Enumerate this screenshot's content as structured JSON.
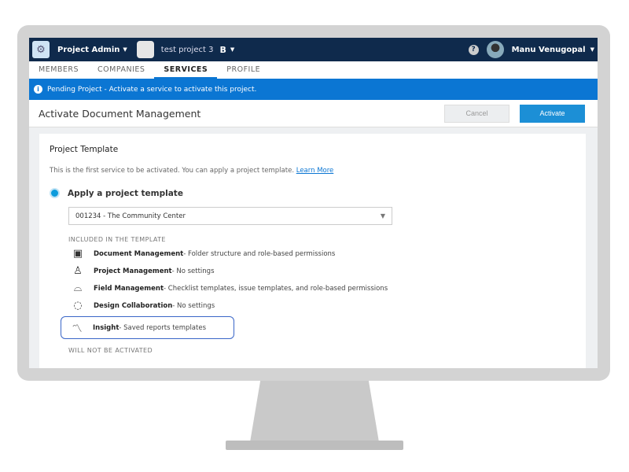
{
  "header": {
    "app_menu": "Project Admin",
    "project": "test project 3",
    "project_badge": "B",
    "user": "Manu Venugopal"
  },
  "tabs": [
    "MEMBERS",
    "COMPANIES",
    "SERVICES",
    "PROFILE"
  ],
  "banner": "Pending Project - Activate a service to activate this project.",
  "title": "Activate Document Management",
  "buttons": {
    "cancel": "Cancel",
    "activate": "Activate"
  },
  "card": {
    "heading": "Project Template",
    "desc": "This is the first service to be activated. You can apply a project template.",
    "learn_more": "Learn More",
    "option": "Apply a project template",
    "selected_template": "001234 - The Community Center",
    "included_label": "INCLUDED IN THE TEMPLATE",
    "not_activated_label": "WILL NOT BE ACTIVATED",
    "items": [
      {
        "name": "Document Management",
        "detail": " - Folder structure and role-based permissions"
      },
      {
        "name": "Project Management",
        "detail": " - No settings"
      },
      {
        "name": "Field Management",
        "detail": " - Checklist templates, issue templates, and role-based permissions"
      },
      {
        "name": "Design Collaboration",
        "detail": " - No settings"
      },
      {
        "name": "Insight",
        "detail": " - Saved reports templates"
      }
    ]
  }
}
